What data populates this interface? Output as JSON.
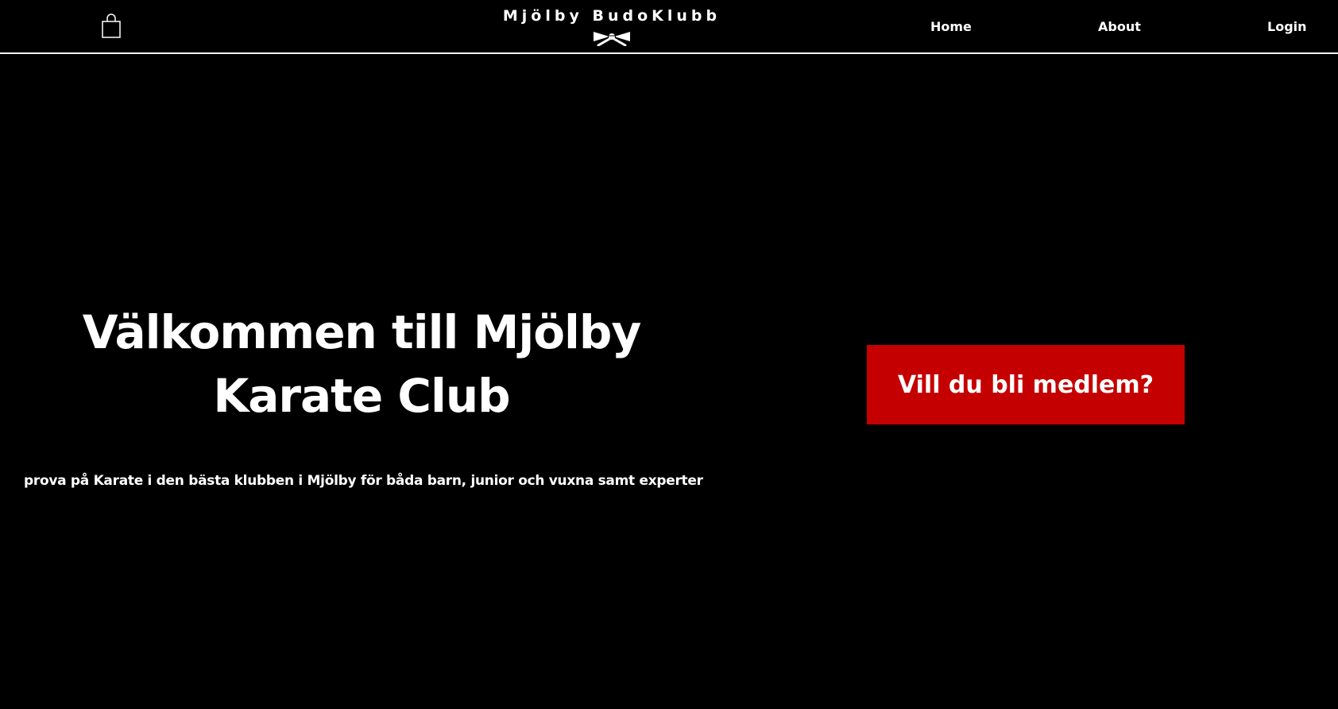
{
  "header": {
    "cart_icon": "shopping-bag-icon",
    "brand_title": "Mjölby BudoKlubb",
    "brand_icon": "karate-belt-icon",
    "nav": {
      "home": "Home",
      "about": "About",
      "login": "Login"
    }
  },
  "hero": {
    "title": "Välkommen till Mjölby Karate Club",
    "subtitle": "prova på Karate i den bästa klubben i Mjölby för båda barn, junior och vuxna samt experter",
    "cta_label": "Vill du bli medlem?"
  },
  "colors": {
    "background": "#000000",
    "text": "#ffffff",
    "cta": "#c50000"
  }
}
